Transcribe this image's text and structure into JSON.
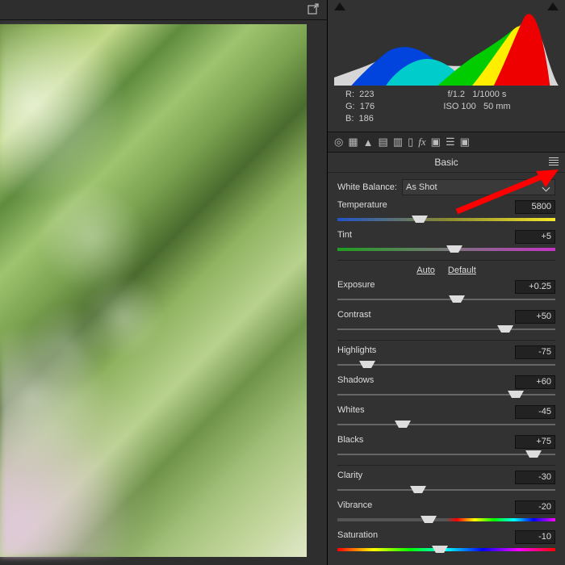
{
  "readout": {
    "r_label": "R:",
    "r": "223",
    "g_label": "G:",
    "g": "176",
    "b_label": "B:",
    "b": "186",
    "aperture": "f/1.2",
    "shutter": "1/1000 s",
    "iso": "ISO 100",
    "focal": "50 mm"
  },
  "panel": {
    "title": "Basic"
  },
  "wb": {
    "label": "White Balance:",
    "value": "As Shot"
  },
  "links": {
    "auto": "Auto",
    "default": "Default"
  },
  "sliders": {
    "temperature": {
      "label": "Temperature",
      "value": "5800",
      "pos": 36
    },
    "tint": {
      "label": "Tint",
      "value": "+5",
      "pos": 52
    },
    "exposure": {
      "label": "Exposure",
      "value": "+0.25",
      "pos": 53
    },
    "contrast": {
      "label": "Contrast",
      "value": "+50",
      "pos": 75
    },
    "highlights": {
      "label": "Highlights",
      "value": "-75",
      "pos": 12
    },
    "shadows": {
      "label": "Shadows",
      "value": "+60",
      "pos": 80
    },
    "whites": {
      "label": "Whites",
      "value": "-45",
      "pos": 28
    },
    "blacks": {
      "label": "Blacks",
      "value": "+75",
      "pos": 88
    },
    "clarity": {
      "label": "Clarity",
      "value": "-30",
      "pos": 35
    },
    "vibrance": {
      "label": "Vibrance",
      "value": "-20",
      "pos": 40
    },
    "saturation": {
      "label": "Saturation",
      "value": "-10",
      "pos": 45
    }
  }
}
